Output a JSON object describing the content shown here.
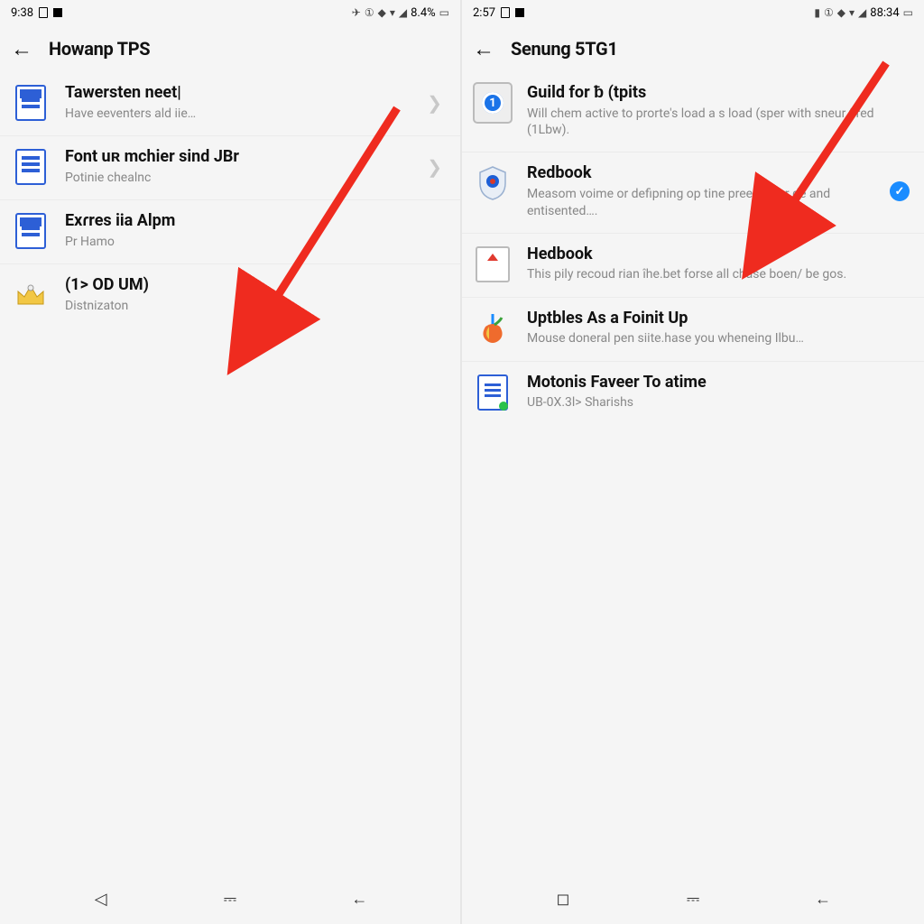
{
  "left": {
    "status": {
      "time": "9:38",
      "battery": "8.4%"
    },
    "title": "Howanp TPS",
    "items": [
      {
        "title": "Tawersten neet|",
        "sub": "Have eeventers ald iie…",
        "icon": "doc-top",
        "chevron": true
      },
      {
        "title": "Font uʀ mchier sind JBr",
        "sub": "Potinie chealnc",
        "icon": "doc",
        "chevron": true
      },
      {
        "title": "Exɾres iіa Alpm",
        "sub": "Pr Hamo",
        "icon": "doc-top",
        "chevron": false
      },
      {
        "title": "(1> OD UM)",
        "sub": "Distnizaton",
        "icon": "crown",
        "chevron": false
      }
    ]
  },
  "right": {
    "status": {
      "time": "2:57",
      "battery": "88:34"
    },
    "title": "Senung 5TG1",
    "items": [
      {
        "title": "Guild for ƀ (tpits",
        "sub": "Will chem active to prorte's load a s load (sper with sneur fired (1Lbw).",
        "icon": "badge",
        "check": false
      },
      {
        "title": "Redbook",
        "sub": "Measom voime or defipning op tine preents for de and entisented….",
        "icon": "shield",
        "check": true
      },
      {
        "title": "Hedbook",
        "sub": "This pily recoud rian îhe.bet forse all chase boen/ be gos.",
        "icon": "upbook",
        "check": false
      },
      {
        "title": "Uptbles As a Foіnit Up",
        "sub": "Mouse doneral pen siite.hase you wheneing Ilbu…",
        "icon": "fruit",
        "check": false
      },
      {
        "title": "Motonis Faveer To atime",
        "sub": "UB-0X.3l> Sharishs",
        "icon": "note",
        "check": false
      }
    ]
  },
  "nav": {
    "back": "◁",
    "home": "◻",
    "recent": "←",
    "pill": "⎓"
  }
}
